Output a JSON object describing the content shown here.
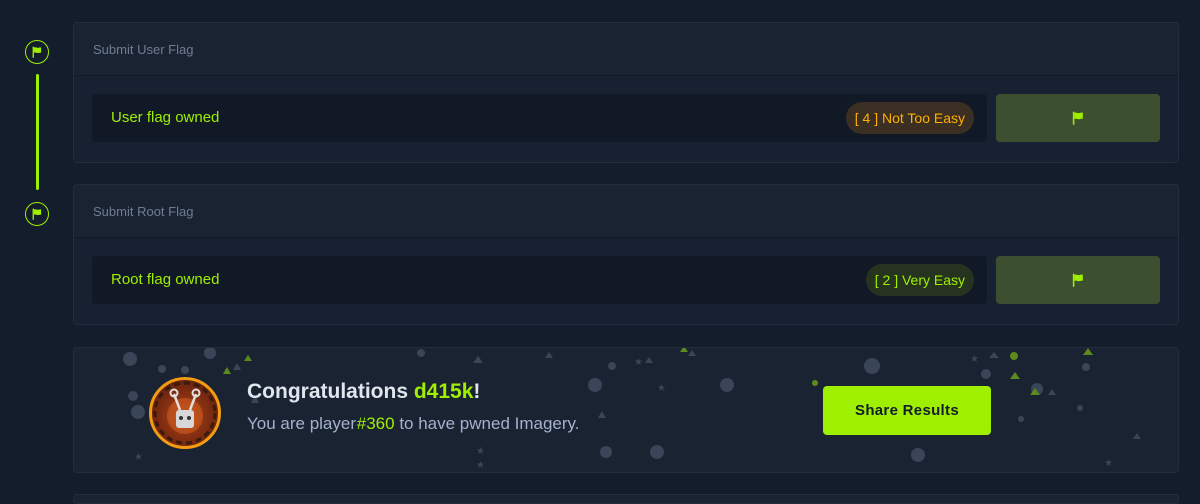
{
  "user_flag": {
    "heading": "Submit User Flag",
    "status": "User flag owned",
    "difficulty": "[ 4 ] Not Too Easy",
    "icon": "flag-icon"
  },
  "root_flag": {
    "heading": "Submit Root Flag",
    "status": "Root flag owned",
    "difficulty": "[ 2 ] Very Easy",
    "icon": "flag-icon"
  },
  "congrats": {
    "title_prefix": "Congratulations",
    "username": "d415k",
    "title_suffix": "!",
    "sub_prefix": "You are player",
    "player_number": "#360",
    "sub_suffix": "to have pwned Imagery.",
    "share_label": "Share Results"
  },
  "colors": {
    "accent": "#9fef00",
    "background": "#141d2b",
    "card": "#1a2332",
    "difficulty_medium": "#ffaf00"
  }
}
